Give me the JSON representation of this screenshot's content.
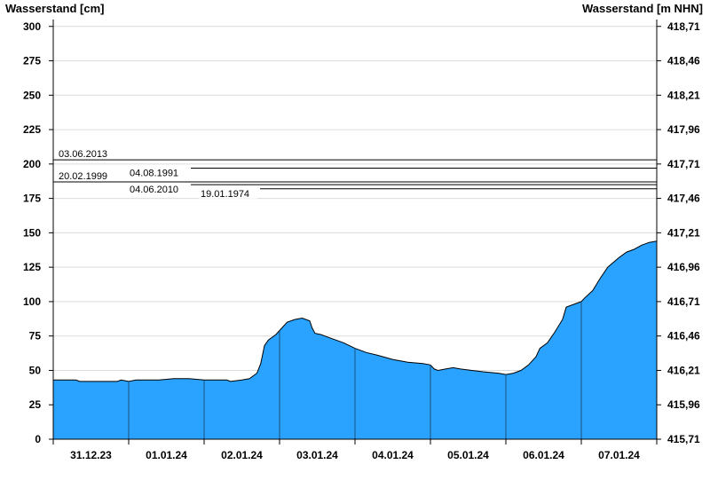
{
  "chart_data": {
    "type": "area",
    "ylabel_left": "Wasserstand [cm]",
    "ylabel_right": "Wasserstand [m NHN]",
    "ylim": [
      0,
      305
    ],
    "left_ticks": [
      0,
      25,
      50,
      75,
      100,
      125,
      150,
      175,
      200,
      225,
      250,
      275,
      300
    ],
    "right_tick_labels": [
      "415,71",
      "415,96",
      "416,21",
      "416,46",
      "416,71",
      "416,96",
      "417,21",
      "417,46",
      "417,71",
      "417,96",
      "418,21",
      "418,46",
      "418,71"
    ],
    "x_ticks": [
      "31.12.23",
      "01.01.24",
      "02.01.24",
      "03.01.24",
      "04.01.24",
      "05.01.24",
      "06.01.24",
      "07.01.24"
    ],
    "xlim": [
      0,
      8
    ],
    "grid": true,
    "fill_color": "#29a3ff",
    "reference_levels": [
      {
        "label": "03.06.2013",
        "value": 203
      },
      {
        "label": "04.08.1991",
        "value": 197
      },
      {
        "label": "20.02.1999",
        "value": 187
      },
      {
        "label": "04.06.2010",
        "value": 185
      },
      {
        "label": "19.01.1974",
        "value": 182
      }
    ],
    "series": [
      {
        "values": [
          [
            0.0,
            43
          ],
          [
            0.3,
            43
          ],
          [
            0.35,
            42
          ],
          [
            0.5,
            42
          ],
          [
            0.6,
            42
          ],
          [
            0.85,
            42
          ],
          [
            0.9,
            43
          ],
          [
            1.0,
            42
          ],
          [
            1.1,
            43
          ],
          [
            1.4,
            43
          ],
          [
            1.6,
            44
          ],
          [
            1.8,
            44
          ],
          [
            2.0,
            43
          ],
          [
            2.3,
            43
          ],
          [
            2.35,
            42
          ],
          [
            2.5,
            43
          ],
          [
            2.6,
            44
          ],
          [
            2.7,
            48
          ],
          [
            2.75,
            55
          ],
          [
            2.8,
            68
          ],
          [
            2.85,
            72
          ],
          [
            2.95,
            76
          ],
          [
            3.0,
            79
          ],
          [
            3.1,
            85
          ],
          [
            3.2,
            87
          ],
          [
            3.3,
            88
          ],
          [
            3.35,
            87
          ],
          [
            3.4,
            86
          ],
          [
            3.43,
            81
          ],
          [
            3.47,
            77
          ],
          [
            3.55,
            76
          ],
          [
            3.6,
            75
          ],
          [
            3.7,
            73
          ],
          [
            3.85,
            70
          ],
          [
            4.0,
            66
          ],
          [
            4.15,
            63
          ],
          [
            4.3,
            61
          ],
          [
            4.5,
            58
          ],
          [
            4.7,
            56
          ],
          [
            4.9,
            55
          ],
          [
            5.0,
            54
          ],
          [
            5.05,
            51
          ],
          [
            5.1,
            50
          ],
          [
            5.2,
            51
          ],
          [
            5.3,
            52
          ],
          [
            5.4,
            51
          ],
          [
            5.55,
            50
          ],
          [
            5.7,
            49
          ],
          [
            5.9,
            48
          ],
          [
            6.0,
            47
          ],
          [
            6.1,
            48
          ],
          [
            6.2,
            50
          ],
          [
            6.3,
            54
          ],
          [
            6.4,
            60
          ],
          [
            6.45,
            66
          ],
          [
            6.55,
            70
          ],
          [
            6.65,
            78
          ],
          [
            6.75,
            87
          ],
          [
            6.8,
            96
          ],
          [
            6.9,
            98
          ],
          [
            7.0,
            100
          ],
          [
            7.05,
            103
          ],
          [
            7.15,
            108
          ],
          [
            7.25,
            117
          ],
          [
            7.35,
            125
          ],
          [
            7.5,
            132
          ],
          [
            7.6,
            136
          ],
          [
            7.7,
            138
          ],
          [
            7.8,
            141
          ],
          [
            7.9,
            143
          ],
          [
            8.0,
            144
          ]
        ]
      }
    ]
  }
}
